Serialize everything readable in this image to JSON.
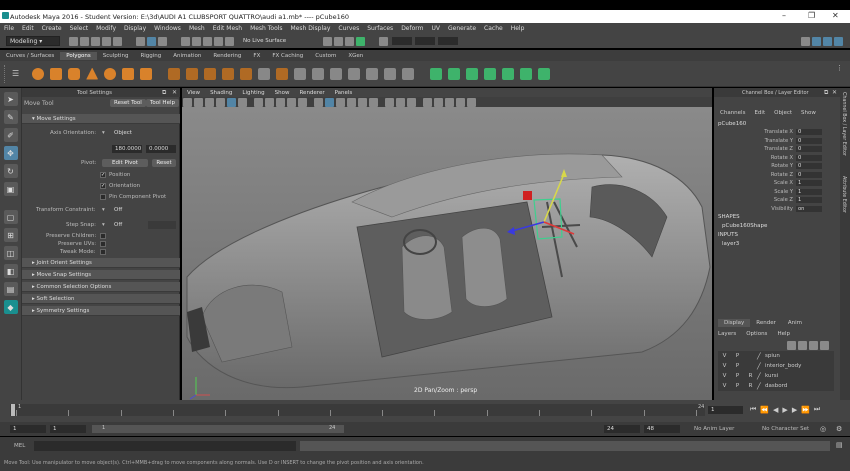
{
  "title_bar": {
    "title": "Autodesk Maya 2016 - Student Version: E:\\3d\\AUDI A1 CLUBSPORT QUATTRO\\audi a1.mb*    ----    pCube160"
  },
  "menu": [
    "File",
    "Edit",
    "Create",
    "Select",
    "Modify",
    "Display",
    "Windows",
    "Mesh",
    "Edit Mesh",
    "Mesh Tools",
    "Mesh Display",
    "Curves",
    "Surfaces",
    "Deform",
    "UV",
    "Generate",
    "Cache",
    "Help"
  ],
  "status_line": {
    "mode": "Modeling",
    "live_surface": "No Live Surface"
  },
  "shelf_tabs": [
    "Curves / Surfaces",
    "Polygons",
    "Sculpting",
    "Rigging",
    "Animation",
    "Rendering",
    "FX",
    "FX Caching",
    "Custom",
    "XGen"
  ],
  "shelf_active": "Polygons",
  "tool_settings": {
    "header": "Tool Settings",
    "tool_name": "Move Tool",
    "reset_tool": "Reset Tool",
    "tool_help": "Tool Help",
    "move_settings": "Move Settings",
    "axis_orientation_label": "Axis Orientation:",
    "axis_orientation_value": "Object",
    "angle_1": "180.0000",
    "angle_2": "0.0000",
    "pivot_label": "Pivot:",
    "edit_pivot": "Edit Pivot",
    "reset": "Reset",
    "position": "Position",
    "orientation": "Orientation",
    "pin_component_pivot": "Pin Component Pivot",
    "transform_constraint_label": "Transform Constraint:",
    "transform_constraint_value": "Off",
    "step_snap_label": "Step Snap:",
    "step_snap_value": "Off",
    "preserve_children": "Preserve Children:",
    "preserve_uvs": "Preserve UVs:",
    "tweak_mode": "Tweak Mode:",
    "sections": [
      "Joint Orient Settings",
      "Move Snap Settings",
      "Common Selection Options",
      "Soft Selection",
      "Symmetry Settings"
    ]
  },
  "viewport": {
    "menu": [
      "View",
      "Shading",
      "Lighting",
      "Show",
      "Renderer",
      "Panels"
    ],
    "hud_label": "2D Pan/Zoom : persp"
  },
  "channel_box": {
    "header": "Channel Box / Layer Editor",
    "tabs": [
      "Channels",
      "Edit",
      "Object",
      "Show"
    ],
    "object_name": "pCube160",
    "attributes": [
      {
        "name": "Translate X",
        "value": "0"
      },
      {
        "name": "Translate Y",
        "value": "0"
      },
      {
        "name": "Translate Z",
        "value": "0"
      },
      {
        "name": "Rotate X",
        "value": "0"
      },
      {
        "name": "Rotate Y",
        "value": "0"
      },
      {
        "name": "Rotate Z",
        "value": "0"
      },
      {
        "name": "Scale X",
        "value": "1"
      },
      {
        "name": "Scale Y",
        "value": "1"
      },
      {
        "name": "Scale Z",
        "value": "1"
      },
      {
        "name": "Visibility",
        "value": "on"
      }
    ],
    "shapes_label": "SHAPES",
    "shape_name": "pCube160Shape",
    "inputs_label": "INPUTS",
    "input_name": "layer3",
    "side_tabs": [
      "Channel Box / Layer Editor",
      "Attribute Editor"
    ]
  },
  "layer_editor": {
    "tabs": [
      "Display",
      "Render",
      "Anim"
    ],
    "menu": [
      "Layers",
      "Options",
      "Help"
    ],
    "layers": [
      {
        "v": "V",
        "p": "P",
        "r": "",
        "name": "spiun"
      },
      {
        "v": "V",
        "p": "P",
        "r": "",
        "name": "interior_body"
      },
      {
        "v": "V",
        "p": "P",
        "r": "R",
        "name": "kursi"
      },
      {
        "v": "V",
        "p": "P",
        "r": "R",
        "name": "dasbord"
      }
    ]
  },
  "time_slider": {
    "ticks": [
      "1",
      "",
      "",
      "",
      "",
      "",
      "",
      "",
      "",
      "",
      "",
      "",
      "",
      "24"
    ],
    "current_frame": "1"
  },
  "range_slider": {
    "start": "1",
    "start_inner": "1",
    "range_bar_left": "1",
    "range_bar_right": "24",
    "end_inner": "24",
    "end": "48",
    "anim_layer": "No Anim Layer",
    "character_set": "No Character Set"
  },
  "command_line": {
    "label": "MEL"
  },
  "help_line": {
    "text": "Move Tool: Use manipulator to move object(s). Ctrl+MMB+drag to move components along normals. Use D or INSERT to change the pivot position and axis orientation."
  },
  "colors": {
    "panel": "#444444",
    "field": "#2b2b2b",
    "accent": "#5285a6",
    "highlight": "#3eb36b"
  }
}
